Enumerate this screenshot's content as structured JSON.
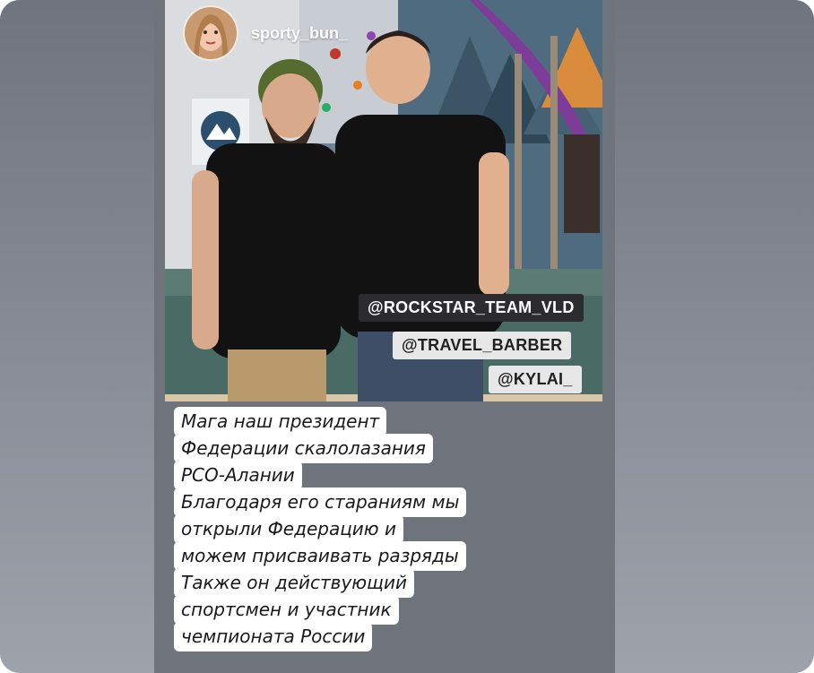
{
  "profile": {
    "username": "sporty_bun_"
  },
  "mentions": [
    "@ROCKSTAR_TEAM_VLD",
    "@TRAVEL_BARBER",
    "@KYLAI_"
  ],
  "caption": {
    "lines": [
      "Мага наш президент",
      "Федерации скалолазания",
      "РСО-Алании",
      "Благодаря его стараниям мы",
      "открыли Федерацию и",
      "можем присваивать разряды",
      "Также он действующий",
      "спортсмен и участник",
      "чемпионата России"
    ]
  },
  "colors": {
    "tag_dark_bg": "#2c2c2e",
    "tag_light_bg": "#e7e7e7",
    "caption_bg": "#ffffff"
  },
  "icons": {
    "avatar": "profile-avatar-woman",
    "logo": "climbing-federation-logo"
  }
}
